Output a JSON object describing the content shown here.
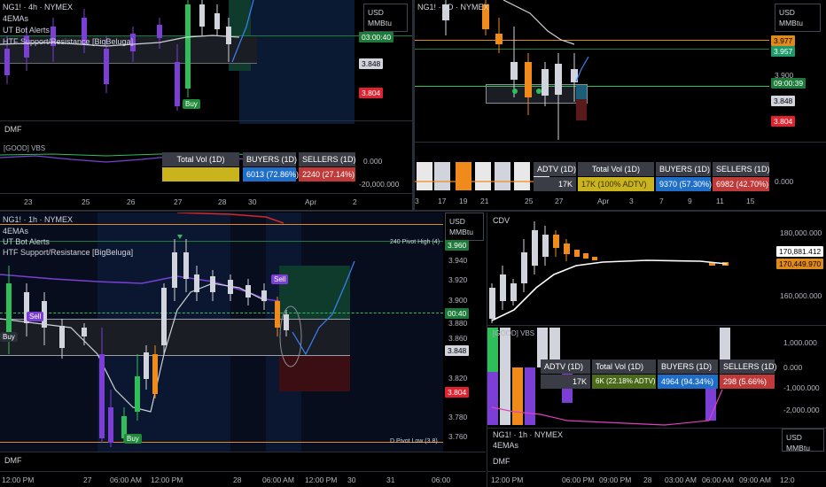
{
  "tl": {
    "title": "NG1! · 4h · NYMEX",
    "ema": "4EMAs",
    "ut": "UT Bot Alerts",
    "htf": "HTF Support/Resistance [BigBeluga]",
    "currency": "USD",
    "unit": "MMBtu",
    "tag_green": "03:00:40",
    "tag_price": "3.848",
    "tag_red": "3.804",
    "buy": "Buy",
    "dmf": "DMF",
    "vbs": "[GOOD] VBS",
    "stats": {
      "total_h": "Total Vol (1D)",
      "buyers_h": "BUYERS (1D)",
      "sellers_h": "SELLERS (1D)",
      "buyers_v": "6013 (72.86%)",
      "sellers_v": "2240 (27.14%)"
    },
    "axis_right": [
      "0.000",
      "-20,000.000"
    ],
    "x_ticks": [
      "23",
      "25",
      "26",
      "27",
      "28",
      "30",
      "Apr",
      "2"
    ]
  },
  "tr": {
    "title": "NG1! · 1D · NYMEX",
    "currency": "USD",
    "unit": "MMBtu",
    "tag_orange": "3.977",
    "tag_green": "3.957",
    "tag_level": "3.900",
    "tag_time": "09:00:39",
    "tag_price": "3.848",
    "tag_red": "3.804",
    "stats": {
      "adtv_h": "ADTV (1D)",
      "total_h": "Total Vol (1D)",
      "buyers_h": "BUYERS (1D)",
      "sellers_h": "SELLERS (1D)",
      "adtv_v": "17K",
      "total_v": "17K (100% ADTV)",
      "buyers_v": "9370 (57.30%)",
      "sellers_v": "6982 (42.70%)"
    },
    "axis_right": "0.000",
    "x_ticks": [
      "3",
      "17",
      "19",
      "21",
      "25",
      "27",
      "Apr",
      "3",
      "7",
      "9",
      "11",
      "15"
    ]
  },
  "bl": {
    "title": "NG1! · 1h · NYMEX",
    "ema": "4EMAs",
    "ut": "UT Bot Alerts",
    "htf": "HTF Support/Resistance [BigBeluga]",
    "currency": "USD",
    "unit": "MMBtu",
    "pivot_high": "240 Pivot High (4)",
    "pivot_low": "D Pivot Low (3.8)",
    "tag_top": "3.960",
    "prices": [
      "3.940",
      "3.920",
      "3.900",
      "3.880",
      "3.860",
      "3.820",
      "3.800",
      "3.780",
      "3.760"
    ],
    "tag_time": "00:40",
    "tag_price": "3.848",
    "tag_red": "3.804",
    "sell1": "Sell",
    "sell2": "Sell",
    "buy1": "Buy",
    "buy2": "Buy",
    "dmf": "DMF",
    "x_ticks": [
      "12:00 PM",
      "27",
      "06:00 AM",
      "12:00 PM",
      "28",
      "06:00 AM",
      "12:00 PM",
      "30",
      "31",
      "06:00"
    ]
  },
  "br": {
    "cdv": "CDV",
    "axis": [
      "180,000.000",
      "160,000.000"
    ],
    "tag_white": "170,881.412",
    "tag_orange": "170,449.970",
    "vbs": "[GOOD] VBS",
    "axis2": [
      "1,000.000",
      "0.000",
      "-1,000.000",
      "-2,000.000"
    ],
    "stats": {
      "adtv_h": "ADTV (1D)",
      "total_h": "Total Vol (1D)",
      "buyers_h": "BUYERS (1D)",
      "sellers_h": "SELLERS (1D)",
      "adtv_v": "17K",
      "total_v": "6K (22.18% ADTV)",
      "buyers_v": "4964 (94.34%)",
      "sellers_v": "298 (5.66%)"
    },
    "bottom_title": "NG1! · 1h · NYMEX",
    "bottom_ema": "4EMAs",
    "currency": "USD",
    "unit": "MMBtu",
    "dmf": "DMF",
    "x_ticks": [
      "12:00 PM",
      "06:00 PM",
      "09:00 PM",
      "28",
      "03:00 AM",
      "06:00 AM",
      "09:00 AM",
      "12:0"
    ]
  }
}
